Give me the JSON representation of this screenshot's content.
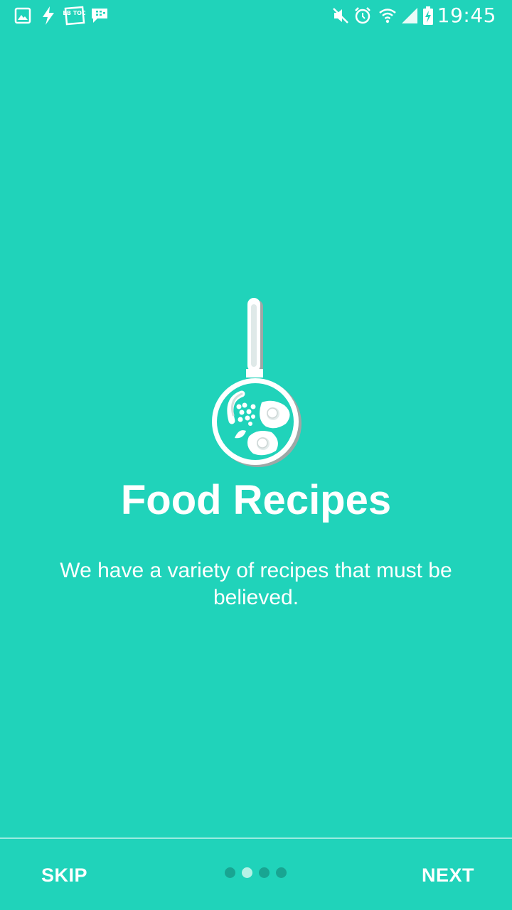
{
  "status_bar": {
    "time": "19:45",
    "left_icons": [
      "gallery-icon",
      "flash-icon",
      "webtoon-icon",
      "bbm-icon"
    ],
    "webtoon_text": "WEB TOON",
    "right_icons": [
      "mute-icon",
      "alarm-icon",
      "wifi-icon",
      "signal-icon",
      "battery-charging-icon"
    ]
  },
  "onboarding": {
    "illustration_icon": "frying-pan-icon",
    "title": "Food Recipes",
    "description": "We have a variety of recipes that must be believed.",
    "page_count": 4,
    "current_page": 2
  },
  "footer": {
    "skip_label": "SKIP",
    "next_label": "NEXT"
  },
  "colors": {
    "background": "#20d3ba",
    "dot_inactive": "#18a592",
    "dot_active": "#b5f2e6",
    "text": "#ffffff"
  }
}
